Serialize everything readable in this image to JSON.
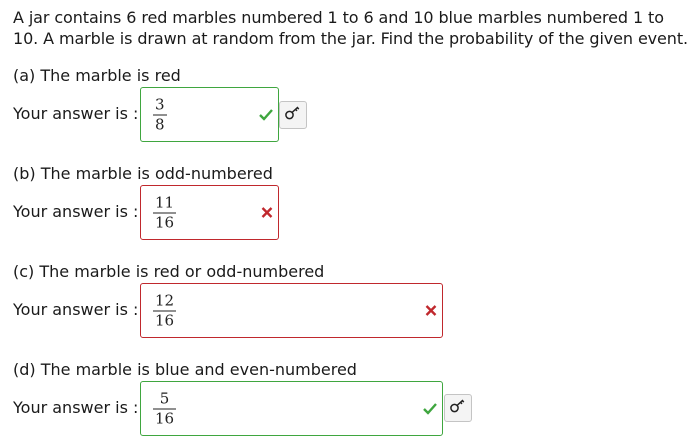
{
  "question": "A jar contains 6 red marbles numbered 1 to 6 and 10 blue marbles numbered 1 to 10. A marble is drawn at random from the jar. Find the probability of the given event.",
  "answer_prefix": "Your answer is :",
  "parts": [
    {
      "label": "(a) The marble is red",
      "numerator": "3",
      "denominator": "8",
      "status": "correct",
      "status_icon": "check-icon",
      "has_key": true
    },
    {
      "label": "(b) The marble is odd-numbered",
      "numerator": "11",
      "denominator": "16",
      "status": "incorrect",
      "status_icon": "cross-icon",
      "has_key": false
    },
    {
      "label": "(c) The marble is red or odd-numbered",
      "numerator": "12",
      "denominator": "16",
      "status": "incorrect",
      "status_icon": "cross-icon",
      "has_key": false
    },
    {
      "label": "(d) The marble is blue and even-numbered",
      "numerator": "5",
      "denominator": "16",
      "status": "correct",
      "status_icon": "check-icon",
      "has_key": true
    }
  ],
  "colors": {
    "correct": "#3fa63f",
    "incorrect": "#c0282d"
  }
}
